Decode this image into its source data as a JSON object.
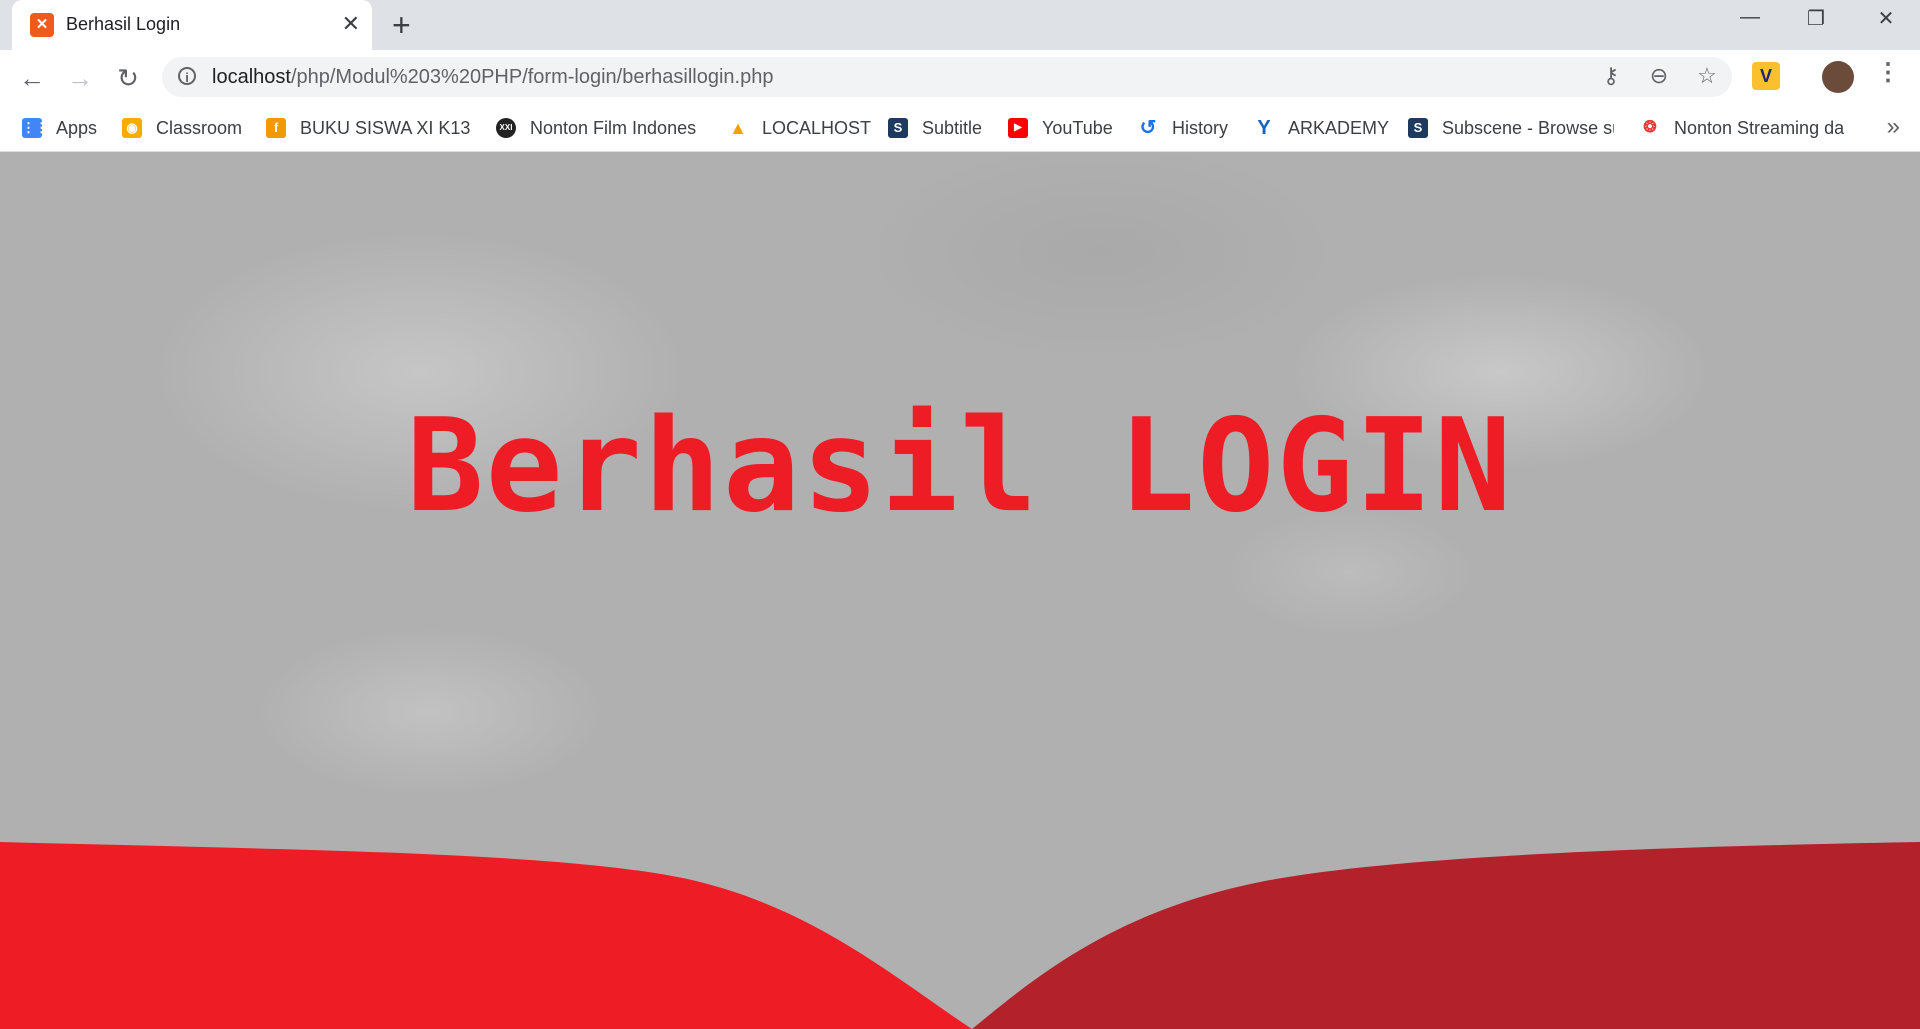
{
  "tab": {
    "title": "Berhasil Login",
    "favicon": "xampp-icon",
    "close": "✕"
  },
  "new_tab_label": "+",
  "window_controls": {
    "minimize": "—",
    "restore": "❐",
    "close": "✕"
  },
  "nav": {
    "back": "←",
    "forward": "→",
    "reload": "↻"
  },
  "address": {
    "host": "localhost",
    "path": "/php/Modul%203%20PHP/form-login/berhasillogin.php"
  },
  "omnibox_icons": {
    "key": "⚷",
    "zoom": "⊖",
    "star": "☆"
  },
  "extension_label": "V",
  "menu_label": "⋮",
  "bookmarks": [
    {
      "label": "Apps",
      "icon": "apps-grid-icon",
      "color": "#4285f4",
      "glyph": "⋮⋮"
    },
    {
      "label": "Classroom",
      "icon": "classroom-icon",
      "color": "#f9ab00",
      "glyph": "◉"
    },
    {
      "label": "BUKU SISWA XI K13 F",
      "icon": "f-icon",
      "color": "#f29900",
      "glyph": "f"
    },
    {
      "label": "Nonton Film Indones",
      "icon": "xxi-icon",
      "color": "#222222",
      "glyph": "XXI"
    },
    {
      "label": "LOCALHOST",
      "icon": "pma-icon",
      "color": "#f4a100",
      "glyph": "▲"
    },
    {
      "label": "Subtitle",
      "icon": "s-icon",
      "color": "#1f3a5f",
      "glyph": "S"
    },
    {
      "label": "YouTube",
      "icon": "youtube-icon",
      "color": "#ff0000",
      "glyph": "▶"
    },
    {
      "label": "History",
      "icon": "history-icon",
      "color": "#1a73e8",
      "glyph": "↺"
    },
    {
      "label": "ARKADEMY",
      "icon": "bird-icon",
      "color": "#1565c0",
      "glyph": "Y"
    },
    {
      "label": "Subscene - Browse su",
      "icon": "s-icon",
      "color": "#1f3a5f",
      "glyph": "S"
    },
    {
      "label": "Nonton Streaming da",
      "icon": "stream-icon",
      "color": "#e53935",
      "glyph": "❂"
    }
  ],
  "bookmarks_more": "»",
  "page": {
    "heading": "Berhasil LOGIN"
  },
  "colors": {
    "heading": "#ee1c25",
    "bottom_left": "#ee1c25",
    "bottom_right": "#b3222a"
  }
}
